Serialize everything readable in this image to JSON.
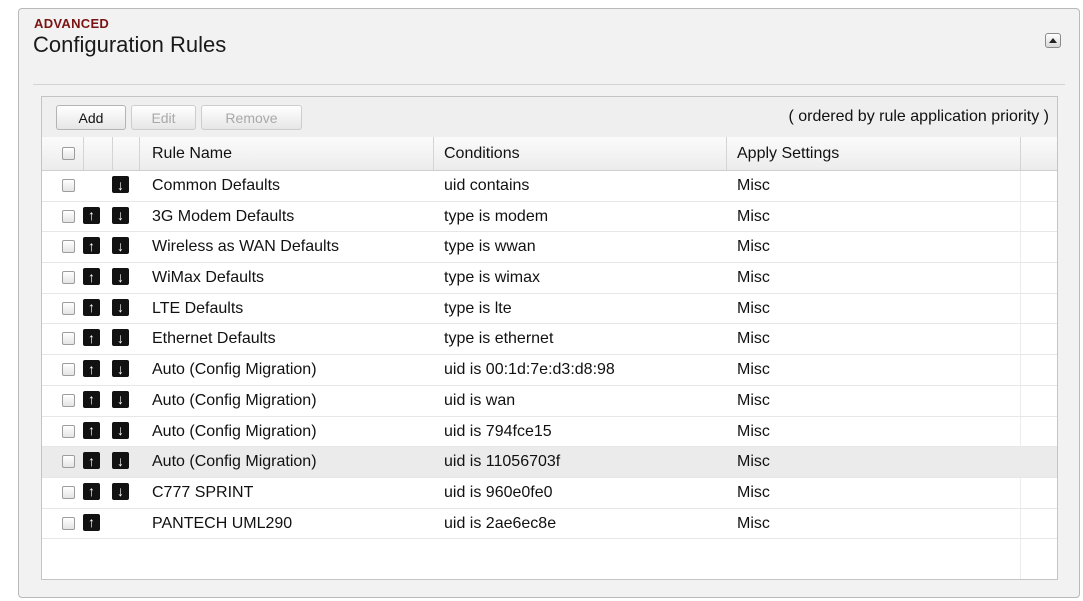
{
  "section": {
    "label": "ADVANCED",
    "title": "Configuration Rules"
  },
  "toolbar": {
    "add_label": "Add",
    "edit_label": "Edit",
    "remove_label": "Remove",
    "note": "( ordered by rule application priority )"
  },
  "table": {
    "headers": {
      "rule_name": "Rule Name",
      "conditions": "Conditions",
      "apply_settings": "Apply Settings"
    },
    "rows": [
      {
        "name": "Common Defaults",
        "condition": "uid contains",
        "apply": "Misc",
        "up": false,
        "down": true,
        "selected": false
      },
      {
        "name": "3G Modem Defaults",
        "condition": "type is modem",
        "apply": "Misc",
        "up": true,
        "down": true,
        "selected": false
      },
      {
        "name": "Wireless as WAN Defaults",
        "condition": "type is wwan",
        "apply": "Misc",
        "up": true,
        "down": true,
        "selected": false
      },
      {
        "name": "WiMax Defaults",
        "condition": "type is wimax",
        "apply": "Misc",
        "up": true,
        "down": true,
        "selected": false
      },
      {
        "name": "LTE Defaults",
        "condition": "type is lte",
        "apply": "Misc",
        "up": true,
        "down": true,
        "selected": false
      },
      {
        "name": "Ethernet Defaults",
        "condition": "type is ethernet",
        "apply": "Misc",
        "up": true,
        "down": true,
        "selected": false
      },
      {
        "name": "Auto (Config Migration)",
        "condition": "uid is 00:1d:7e:d3:d8:98",
        "apply": "Misc",
        "up": true,
        "down": true,
        "selected": false
      },
      {
        "name": "Auto (Config Migration)",
        "condition": "uid is wan",
        "apply": "Misc",
        "up": true,
        "down": true,
        "selected": false
      },
      {
        "name": "Auto (Config Migration)",
        "condition": "uid is 794fce15",
        "apply": "Misc",
        "up": true,
        "down": true,
        "selected": false
      },
      {
        "name": "Auto (Config Migration)",
        "condition": "uid is 11056703f",
        "apply": "Misc",
        "up": true,
        "down": true,
        "selected": true
      },
      {
        "name": "C777 SPRINT",
        "condition": "uid is 960e0fe0",
        "apply": "Misc",
        "up": true,
        "down": true,
        "selected": false
      },
      {
        "name": "PANTECH UML290",
        "condition": "uid is 2ae6ec8e",
        "apply": "Misc",
        "up": true,
        "down": false,
        "selected": false
      }
    ]
  },
  "icons": {
    "up": "arrow-up-icon",
    "down": "arrow-down-icon",
    "collapse": "collapse-up-icon"
  },
  "colors": {
    "section_label": "#7a1414",
    "arrow_bg": "#121212",
    "selected_row": "#ebebeb"
  }
}
